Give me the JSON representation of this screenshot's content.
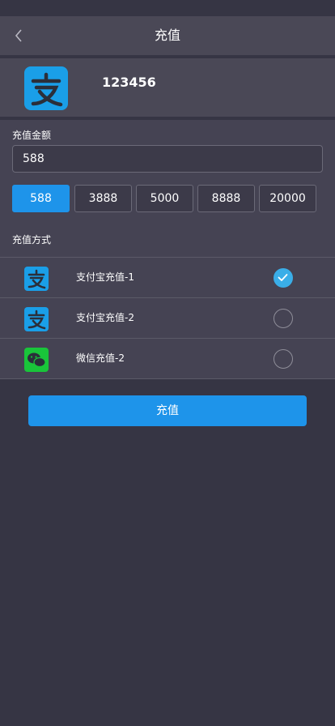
{
  "header": {
    "title": "充值",
    "back_icon": "chevron-left-icon"
  },
  "account": {
    "logo_icon": "alipay-icon",
    "id": "123456"
  },
  "amount": {
    "section_label": "充值金额",
    "value": "588",
    "options": [
      "588",
      "3888",
      "5000",
      "8888",
      "20000"
    ],
    "selected": "588"
  },
  "methods": {
    "section_label": "充值方式",
    "items": [
      {
        "label": "支付宝充值-1",
        "icon": "alipay-icon",
        "checked": true
      },
      {
        "label": "支付宝充值-2",
        "icon": "alipay-icon",
        "checked": false
      },
      {
        "label": "微信充值-2",
        "icon": "wechat-icon",
        "checked": false
      }
    ]
  },
  "submit_label": "充值",
  "colors": {
    "background": "#363544",
    "panel": "#454353",
    "header": "#4a4856",
    "accent": "#1e94ea",
    "check": "#3aaee8",
    "alipay": "#1a9fe8",
    "wechat": "#19c53a"
  }
}
